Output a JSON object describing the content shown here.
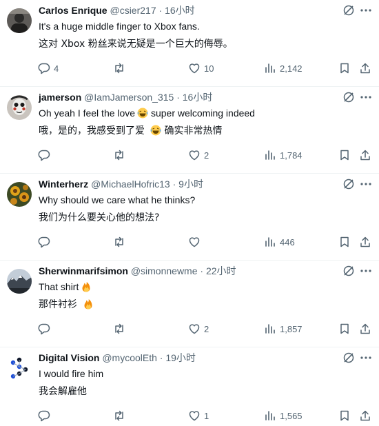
{
  "posts": [
    {
      "name": "Carlos Enrique",
      "handle": "@csier217",
      "dot": "·",
      "time": "16小时",
      "text": "It's a huge middle finger to Xbox fans.",
      "translation": "这对 Xbox 粉丝来说无疑是一个巨大的侮辱。",
      "emoji": "",
      "replies": "4",
      "reposts": "",
      "likes": "10",
      "views": "2,142"
    },
    {
      "name": "jamerson",
      "handle": "@IamJamerson_315",
      "dot": "·",
      "time": "16小时",
      "text": "Oh yeah I feel the love",
      "text_after_emoji": " super welcoming indeed",
      "translation": "哦，是的，我感受到了爱",
      "translation_after_emoji": " 确实非常热情",
      "emoji": "laughing-emoji",
      "replies": "",
      "reposts": "",
      "likes": "2",
      "views": "1,784"
    },
    {
      "name": "Winterherz",
      "handle": "@MichaelHofric13",
      "dot": "·",
      "time": "9小时",
      "text": "Why should we care what he thinks?",
      "translation": "我们为什么要关心他的想法?",
      "emoji": "",
      "replies": "",
      "reposts": "",
      "likes": "",
      "views": "446"
    },
    {
      "name": "Sherwinmarifsimon",
      "handle": "@simonnewme",
      "dot": "·",
      "time": "22小时",
      "text": "That shirt",
      "translation": "那件衬衫",
      "emoji": "fire-emoji",
      "replies": "",
      "reposts": "",
      "likes": "2",
      "views": "1,857"
    },
    {
      "name": "Digital Vision",
      "handle": "@mycoolEth",
      "dot": "·",
      "time": "19小时",
      "text": "I would fire him",
      "translation": "我会解雇他",
      "emoji": "",
      "replies": "",
      "reposts": "",
      "likes": "1",
      "views": "1,565"
    }
  ],
  "icons": {
    "reply": "reply-icon",
    "repost": "repost-icon",
    "like": "like-icon",
    "views": "views-icon",
    "bookmark": "bookmark-icon",
    "share": "share-icon",
    "grok": "grok-icon",
    "more": "more-icon"
  },
  "colors": {
    "text": "#0f1419",
    "muted": "#536471",
    "divider": "#eff3f4"
  }
}
